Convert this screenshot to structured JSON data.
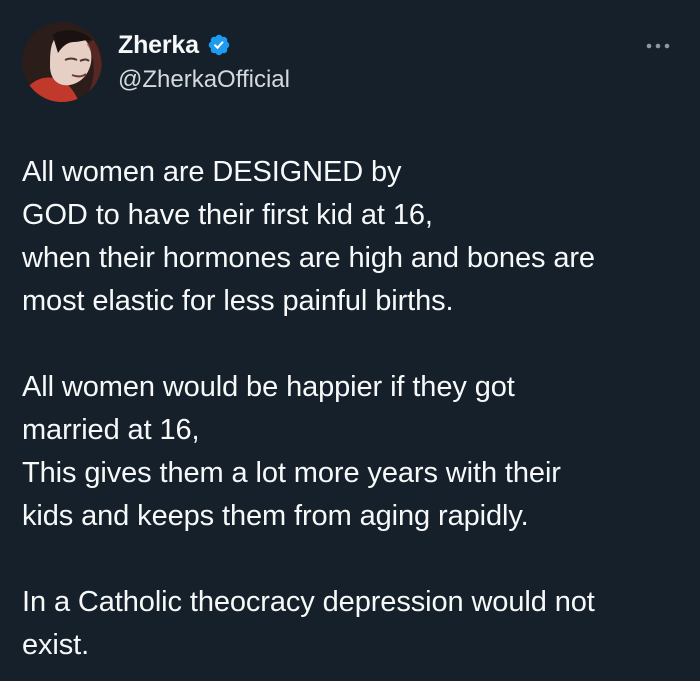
{
  "author": {
    "display_name": "Zherka",
    "handle": "@ZherkaOfficial",
    "verified_icon": "verified-badge-icon",
    "more_icon": "more-options-icon",
    "accent_color": "#1d9bf0"
  },
  "tweet": {
    "text": "All women are DESIGNED by\nGOD to have their first kid at 16,\nwhen their hormones are high and bones are\nmost elastic for less painful births.\n\nAll women would be happier if they got\nmarried at 16,\nThis gives them a lot more years with their\nkids and keeps them from aging rapidly.\n\nIn a Catholic theocracy depression would not\nexist."
  }
}
